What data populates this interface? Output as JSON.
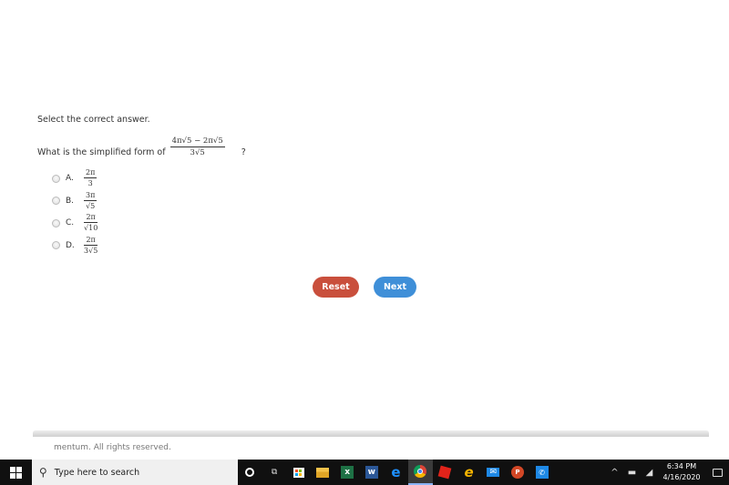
{
  "instruction": "Select the correct answer.",
  "question": {
    "text": "What is the simplified form of",
    "expression": {
      "numerator": "4π√5 − 2π√5",
      "denominator": "3√5"
    },
    "suffix": "?"
  },
  "choices": [
    {
      "letter": "A.",
      "numerator": "2π",
      "denominator": "3"
    },
    {
      "letter": "B.",
      "numerator": "3π",
      "denominator": "√5"
    },
    {
      "letter": "C.",
      "numerator": "2π",
      "denominator": "√10"
    },
    {
      "letter": "D.",
      "numerator": "2π",
      "denominator": "3√5"
    }
  ],
  "buttons": {
    "reset": "Reset",
    "next": "Next"
  },
  "colors": {
    "reset": "#c94f3c",
    "next": "#3f8fd8"
  },
  "footer": {
    "copyright": "mentum. All rights reserved."
  },
  "taskbar": {
    "search_placeholder": "Type here to search",
    "apps": [
      "cortana-icon",
      "task-view-icon",
      "store-icon",
      "file-explorer-icon",
      "excel-icon",
      "word-icon",
      "edge-icon",
      "chrome-icon",
      "roblox-icon",
      "internet-explorer-icon",
      "mail-icon",
      "powerpoint-icon",
      "whatsapp-icon"
    ],
    "time": "6:34 PM",
    "date": "4/16/2020"
  }
}
